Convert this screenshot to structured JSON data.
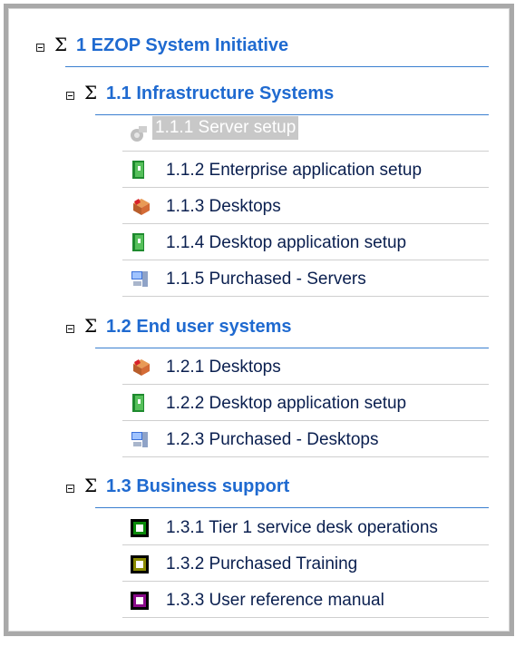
{
  "tree": {
    "root": {
      "number": "1",
      "label": "1 EZOP System Initiative",
      "sigma": "Σ"
    },
    "groups": [
      {
        "label": "1.1 Infrastructure Systems",
        "items": [
          {
            "label": "1.1.1 Server setup",
            "icon": "server-setup-icon",
            "selected": true
          },
          {
            "label": "1.1.2 Enterprise application setup",
            "icon": "green-book-icon"
          },
          {
            "label": "1.1.3 Desktops",
            "icon": "box-package-icon"
          },
          {
            "label": "1.1.4 Desktop application setup",
            "icon": "green-book-icon"
          },
          {
            "label": "1.1.5 Purchased - Servers",
            "icon": "computer-icon"
          }
        ]
      },
      {
        "label": "1.2 End user systems",
        "items": [
          {
            "label": "1.2.1 Desktops",
            "icon": "box-package-icon"
          },
          {
            "label": "1.2.2 Desktop application setup",
            "icon": "green-book-icon"
          },
          {
            "label": "1.2.3 Purchased - Desktops",
            "icon": "computer-icon"
          }
        ]
      },
      {
        "label": "1.3 Business support",
        "items": [
          {
            "label": "1.3.1 Tier 1 service desk operations",
            "icon": "green-square-icon",
            "color": "#0a8a0a"
          },
          {
            "label": "1.3.2 Purchased Training",
            "icon": "olive-square-icon",
            "color": "#8a8a00"
          },
          {
            "label": "1.3.3 User reference manual",
            "icon": "purple-square-icon",
            "color": "#8a0a8a"
          }
        ]
      }
    ]
  }
}
